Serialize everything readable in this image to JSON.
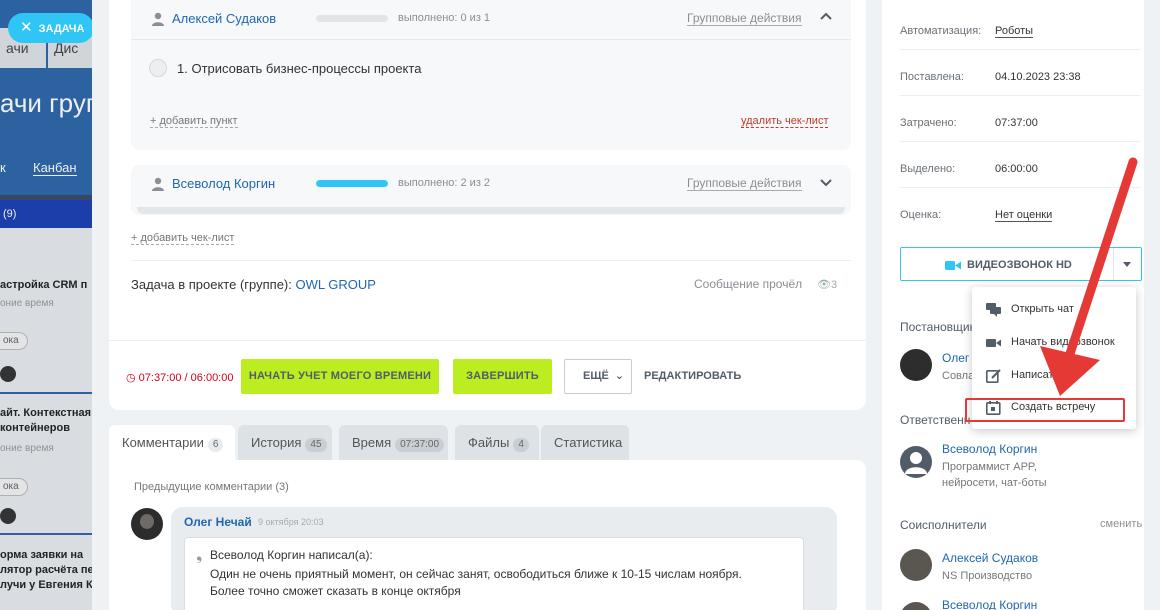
{
  "background": {
    "task_chip": "ЗАДАЧА",
    "tab1": "ачи",
    "tab2": "Дис",
    "title": "ачи групп",
    "tabs2": [
      "к",
      "Канбан"
    ],
    "band": "(9)",
    "cards": [
      {
        "title": "астройка CRM п",
        "sub": "оние время",
        "chip": "ока"
      },
      {
        "title": "айт. Контекстная\nконтейнеров",
        "sub": "оние время",
        "chip": "ока"
      },
      {
        "title": "орма заявки на\nлятор расчёта пе\nлучи у Евгения Кор",
        "sub": "",
        "chip": ""
      }
    ]
  },
  "checklists": [
    {
      "user": "Алексей Судаков",
      "progress": 0.0,
      "done_text": "выполнено: 0 из 1",
      "group_actions": "Групповые действия",
      "items": [
        "1. Отрисовать бизнес-процессы проекта"
      ],
      "add_item": "+ добавить пункт",
      "delete": "удалить чек-лист"
    },
    {
      "user": "Всеволод Коргин",
      "progress": 1.0,
      "done_text": "выполнено: 2 из 2",
      "group_actions": "Групповые действия"
    }
  ],
  "add_checklist": "+ добавить чек-лист",
  "project": {
    "label": "Задача в проекте (группе): ",
    "link": "OWL GROUP",
    "message_read": "Сообщение прочёл",
    "views": "3"
  },
  "actions": {
    "timer": "07:37:00 / 06:00:00",
    "start_time": "НАЧАТЬ УЧЕТ МОЕГО ВРЕМЕНИ",
    "finish": "ЗАВЕРШИТЬ",
    "more": "ЕЩЁ",
    "edit": "РЕДАКТИРОВАТЬ"
  },
  "tabs": [
    {
      "label": "Комментарии",
      "count": "6"
    },
    {
      "label": "История",
      "count": "45"
    },
    {
      "label": "Время",
      "count": "07:37:00"
    },
    {
      "label": "Файлы",
      "count": "4"
    },
    {
      "label": "Статистика",
      "count": ""
    }
  ],
  "comments": {
    "previous": "Предыдущие комментарии",
    "previous_count": "(3)",
    "author": "Олег Нечай",
    "date": "9 октября 20:03",
    "quote_head": "Всеволод Коргин написал(а):",
    "quote_body": "Один не очень приятный момент, он сейчас занят, освободиться ближе к 10-15 числам ноября. Более точно сможет сказать в конце октября"
  },
  "sidebar": {
    "rows": [
      {
        "label": "Автоматизация:",
        "value": "Роботы",
        "link": true
      },
      {
        "label": "Поставлена:",
        "value": "04.10.2023 23:38",
        "link": false
      },
      {
        "label": "Затрачено:",
        "value": "07:37:00",
        "link": false
      },
      {
        "label": "Выделено:",
        "value": "06:00:00",
        "link": false
      },
      {
        "label": "Оценка:",
        "value": "Нет оценки",
        "link": true
      }
    ],
    "videocall": "ВИДЕОЗВОНОК HD",
    "creator_head": "Постановщик",
    "creator_name": "Олег",
    "creator_role": "Совла",
    "responsible_head": "Ответственн",
    "responsible_name": "Всеволод Коргин",
    "responsible_role": "Программист APP,\nнейросети, чат-боты",
    "coexec_head": "Соисполнители",
    "coexec_change": "сменить",
    "coexec": [
      {
        "name": "Алексей Судаков",
        "role": "NS Производство"
      },
      {
        "name": "Всеволод Коргин",
        "role": ""
      }
    ]
  },
  "menu": {
    "items": [
      {
        "label": "Открыть чат",
        "icon": "chat-icon"
      },
      {
        "label": "Начать видеозвонок",
        "icon": "video-camera-icon"
      },
      {
        "label": "Написать",
        "icon": "edit-icon"
      },
      {
        "label": "Создать встречу",
        "icon": "calendar-icon"
      }
    ]
  },
  "colors": {
    "accent": "#2fc6f6",
    "green_button": "#bbed21",
    "link": "#2067b0",
    "annotation": "#e53935"
  }
}
